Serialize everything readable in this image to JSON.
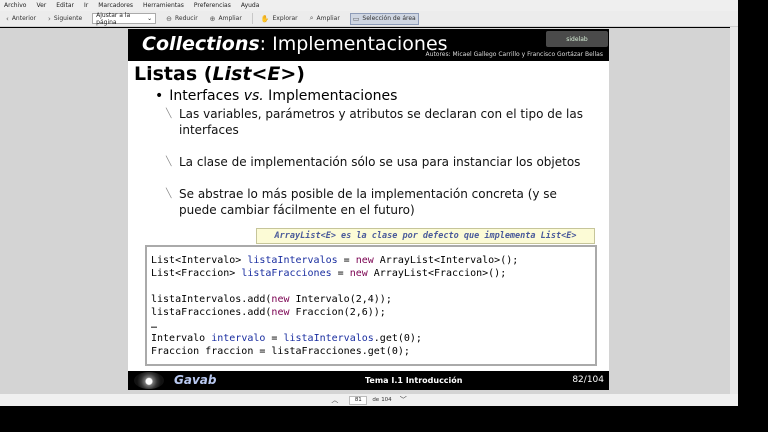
{
  "menubar": {
    "items": [
      "Archivo",
      "Ver",
      "Editar",
      "Ir",
      "Marcadores",
      "Herramientas",
      "Preferencias",
      "Ayuda"
    ]
  },
  "toolbar": {
    "back_label": "Anterior",
    "next_label": "Siguiente",
    "zoom_select": "Ajustar a la página",
    "zoom_out_label": "Reducir",
    "zoom_in_label": "Ampliar",
    "browse_label": "Explorar",
    "magnify_label": "Ampliar",
    "select_area_label": "Selección de área"
  },
  "slide": {
    "title_prefix": "Collections",
    "title_suffix": ": Implementaciones",
    "logo_text": "sidelab",
    "authors": "Autores: Micael Gallego Carrillo y Francisco Gortázar Bellas",
    "heading_prefix": "Listas (",
    "heading_code": "List<E>",
    "heading_suffix": ")",
    "bullet_prefix": "Interfaces ",
    "bullet_italic": "vs.",
    "bullet_suffix": " Implementaciones",
    "sub_items": [
      "Las variables, parámetros y atributos se declaran con el tipo de las interfaces",
      "La clase de implementación sólo se usa para instanciar los objetos",
      "Se abstrae lo más posible de la implementación concreta (y se puede cambiar fácilmente en el futuro)"
    ],
    "code_banner": "ArrayList<E> es la clase por defecto que implementa List<E>",
    "code": {
      "l1_a": "List<Intervalo> ",
      "l1_var": "listaIntervalos",
      "l1_b": " = ",
      "l1_kw": "new",
      "l1_c": " ArrayList<Intervalo>();",
      "l2_a": "List<Fraccion> ",
      "l2_var": "listaFracciones",
      "l2_b": " = ",
      "l2_kw": "new",
      "l2_c": " ArrayList<Fraccion>();",
      "l3_a": "listaIntervalos.add(",
      "l3_kw": "new",
      "l3_c": " Intervalo(2,4));",
      "l4_a": "listaFracciones.add(",
      "l4_kw": "new",
      "l4_c": " Fraccion(2,6));",
      "l5": "…",
      "l6_a": "Intervalo ",
      "l6_var": "intervalo",
      "l6_b": " = ",
      "l6_var2": "listaIntervalos",
      "l6_c": ".get(0);",
      "l7": "Fraccion fraccion = listaFracciones.get(0);"
    },
    "footer_brand": "Gavab",
    "footer_topic": "Tema I.1 Introducción",
    "footer_page": "82/104"
  },
  "navbar": {
    "current_page": "81",
    "of_label": "de",
    "total_pages": "104"
  }
}
